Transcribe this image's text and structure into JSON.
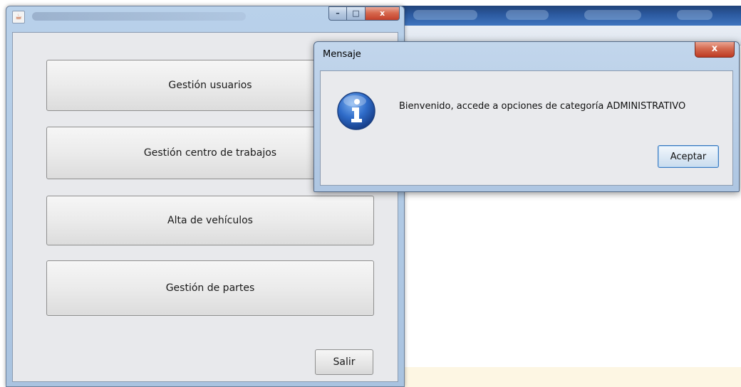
{
  "main_window": {
    "icon": "java-cup-icon",
    "buttons": {
      "usuarios": "Gestión usuarios",
      "centros": "Gestión centro de trabajos",
      "vehiculos": "Alta de vehículos",
      "partes": "Gestión de partes",
      "salir": "Salir"
    },
    "controls": {
      "minimize": "–",
      "maximize": "□",
      "close": "x"
    }
  },
  "dialog": {
    "title": "Mensaje",
    "close": "x",
    "icon": "info-icon",
    "message": "Bienvenido, accede a opciones de categoría ADMINISTRATIVO",
    "ok_label": "Aceptar"
  },
  "colors": {
    "titlebar_bg": "#b9d1ea",
    "close_red": "#c2402a",
    "info_blue": "#2f6cc9",
    "content_bg": "#e8e9ec"
  }
}
